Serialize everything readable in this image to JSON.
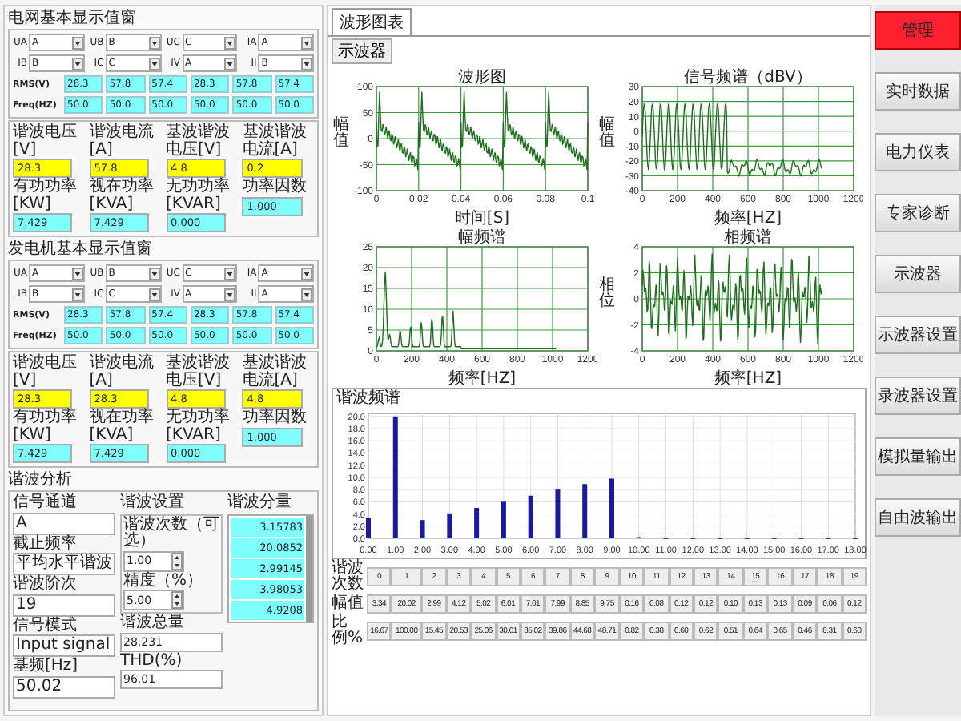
{
  "left_panel": {
    "groups": [
      {
        "title": "电网基本显示值窗",
        "selectors": [
          {
            "label": "UA",
            "value": "A"
          },
          {
            "label": "UB",
            "value": "B"
          },
          {
            "label": "UC",
            "value": "C"
          },
          {
            "label": "IA",
            "value": "A"
          },
          {
            "label": "IB",
            "value": "B"
          },
          {
            "label": "IC",
            "value": "C"
          },
          {
            "label": "IV",
            "value": "A"
          },
          {
            "label": "II",
            "value": "B"
          }
        ],
        "rms_label": "RMS(V)",
        "rms": [
          "28.3",
          "57.8",
          "57.4",
          "28.3",
          "57.8",
          "57.4"
        ],
        "freq_label": "Freq(HZ)",
        "freq": [
          "50.0",
          "50.0",
          "50.0",
          "50.0",
          "50.0",
          "50.0"
        ],
        "measures": [
          {
            "label": "谐波电压[V]",
            "value": "28.3",
            "color": "#ffff00"
          },
          {
            "label": "谐波电流[A]",
            "value": "57.8",
            "color": "#ffff00"
          },
          {
            "label": "基波谐波电压[V]",
            "value": "4.8",
            "color": "#ffff00"
          },
          {
            "label": "基波谐波电流[A]",
            "value": "0.2",
            "color": "#ffff00"
          },
          {
            "label": "有功功率[KW]",
            "value": "7.429",
            "color": "#80ffff"
          },
          {
            "label": "视在功率[KVA]",
            "value": "7.429",
            "color": "#80ffff"
          },
          {
            "label": "无功功率[KVAR]",
            "value": "0.000",
            "color": "#80ffff"
          },
          {
            "label": "功率因数",
            "value": "1.000",
            "color": "#80ffff"
          }
        ]
      },
      {
        "title": "发电机基本显示值窗",
        "selectors": [
          {
            "label": "UA",
            "value": "A"
          },
          {
            "label": "UB",
            "value": "B"
          },
          {
            "label": "UC",
            "value": "C"
          },
          {
            "label": "IA",
            "value": "A"
          },
          {
            "label": "IB",
            "value": "B"
          },
          {
            "label": "IC",
            "value": "C"
          },
          {
            "label": "IV",
            "value": "A"
          },
          {
            "label": "II",
            "value": "A"
          }
        ],
        "rms_label": "RMS(V)",
        "rms": [
          "28.3",
          "57.8",
          "57.4",
          "28.3",
          "57.8",
          "57.4"
        ],
        "freq_label": "Freq(HZ)",
        "freq": [
          "50.0",
          "50.0",
          "50.0",
          "50.0",
          "50.0",
          "50.0"
        ],
        "measures": [
          {
            "label": "谐波电压[V]",
            "value": "28.3",
            "color": "#ffff00"
          },
          {
            "label": "谐波电流[A]",
            "value": "28.3",
            "color": "#ffff00"
          },
          {
            "label": "基波谐波电压[V]",
            "value": "4.8",
            "color": "#ffff00"
          },
          {
            "label": "基波谐波电流[A]",
            "value": "4.8",
            "color": "#ffff00"
          },
          {
            "label": "有功功率[KW]",
            "value": "7.429",
            "color": "#80ffff"
          },
          {
            "label": "视在功率[KVA]",
            "value": "7.429",
            "color": "#80ffff"
          },
          {
            "label": "无功功率[KVAR]",
            "value": "0.000",
            "color": "#80ffff"
          },
          {
            "label": "功率因数",
            "value": "1.000",
            "color": "#80ffff"
          }
        ]
      }
    ],
    "analysis": {
      "title": "谐波分析",
      "fields": [
        {
          "label": "信号通道",
          "value": "A"
        },
        {
          "label": "截止频率",
          "value": "平均水平谐波"
        },
        {
          "label": "谐波阶次",
          "value": "19"
        },
        {
          "label": "信号模式",
          "value": "Input signal"
        },
        {
          "label": "基频[Hz]",
          "value": "50.02"
        }
      ],
      "settings": {
        "title": "谐波设置",
        "spinners": [
          {
            "label": "谐波次数（可选）",
            "value": "1.00"
          },
          {
            "label": "精度（%）",
            "value": "5.00"
          }
        ],
        "outputs": [
          {
            "label": "谐波总量",
            "value": "28.231"
          },
          {
            "label": "THD(%)",
            "value": "96.01"
          }
        ]
      },
      "components": {
        "title": "谐波分量",
        "values": [
          "3.15783",
          "20.0852",
          "2.99145",
          "3.98053",
          "4.9208"
        ]
      }
    }
  },
  "tabs": [
    {
      "label": "波形图表",
      "selected": true
    }
  ],
  "scope_button": "示波器",
  "charts": [
    {
      "kind": "time",
      "title": "波形图",
      "xlabel": "时间[S]",
      "ylabel": "幅值",
      "xticks": [
        "0",
        "0.02",
        "0.04",
        "0.06",
        "0.08",
        "0.1"
      ],
      "yticks": [
        "100",
        "50",
        "0",
        "-50",
        "-100"
      ]
    },
    {
      "kind": "db",
      "title": "信号频谱（dBV）",
      "xlabel": "频率[HZ]",
      "ylabel": "幅值",
      "xticks": [
        "0",
        "200",
        "400",
        "600",
        "800",
        "1000",
        "1200"
      ],
      "yticks": [
        "30",
        "20",
        "10",
        "0",
        "-10",
        "-20",
        "-30",
        "-40"
      ]
    },
    {
      "kind": "magnitude",
      "title": "幅频谱",
      "xlabel": "频率[HZ]",
      "xticks": [
        "0",
        "200",
        "400",
        "600",
        "800",
        "1000",
        "1200"
      ],
      "yticks": [
        "25",
        "20",
        "15",
        "10",
        "5",
        "0"
      ]
    },
    {
      "kind": "phase",
      "title": "相频谱",
      "xlabel": "频率[HZ]",
      "ylabel": "相位",
      "xticks": [
        "0",
        "200",
        "400",
        "600",
        "800",
        "1000",
        "1200"
      ],
      "yticks": [
        "4",
        "2",
        "0",
        "-2",
        "-4"
      ]
    }
  ],
  "harmonic_chart": {
    "chart_data": {
      "type": "bar",
      "title": "谐波频谱",
      "x": [
        0,
        1,
        2,
        3,
        4,
        5,
        6,
        7,
        8,
        9,
        10,
        11,
        12,
        13,
        14,
        15,
        16,
        17,
        18
      ],
      "values": [
        3.3,
        20,
        3,
        4.1,
        5,
        6,
        7,
        8,
        8.9,
        9.8,
        0.2,
        0.1,
        0.1,
        0.1,
        0.1,
        0.1,
        0.1,
        0.1,
        0.1
      ],
      "xlim": [
        0,
        18
      ],
      "ylim": [
        0,
        20.5
      ],
      "grid": true,
      "xticks": [
        {
          "value": 0,
          "label": "0.00"
        },
        {
          "value": 1,
          "label": "1.00"
        },
        {
          "value": 2,
          "label": "2.00"
        },
        {
          "value": 3,
          "label": "3.00"
        },
        {
          "value": 4,
          "label": "4.00"
        },
        {
          "value": 5,
          "label": "5.00"
        },
        {
          "value": 6,
          "label": "6.00"
        },
        {
          "value": 7,
          "label": "7.00"
        },
        {
          "value": 8,
          "label": "8.00"
        },
        {
          "value": 9,
          "label": "9.00"
        },
        {
          "value": 10,
          "label": "10.00"
        },
        {
          "value": 11,
          "label": "11.00"
        },
        {
          "value": 12,
          "label": "12.00"
        },
        {
          "value": 13,
          "label": "13.00"
        },
        {
          "value": 14,
          "label": "14.00"
        },
        {
          "value": 15,
          "label": "15.00"
        },
        {
          "value": 16,
          "label": "16.00"
        },
        {
          "value": 17,
          "label": "17.00"
        },
        {
          "value": 18,
          "label": "18.00"
        }
      ],
      "yticks": [
        {
          "value": 0,
          "label": "0.0"
        },
        {
          "value": 2,
          "label": "2.0"
        },
        {
          "value": 4,
          "label": "4.0"
        },
        {
          "value": 6,
          "label": "6.0"
        },
        {
          "value": 8,
          "label": "8.0"
        },
        {
          "value": 10,
          "label": "10.0"
        },
        {
          "value": 12,
          "label": "12.0"
        },
        {
          "value": 14,
          "label": "14.0"
        },
        {
          "value": 16,
          "label": "16.0"
        },
        {
          "value": 18,
          "label": "18.0"
        },
        {
          "value": 20,
          "label": "20.0"
        }
      ]
    }
  },
  "harmonic_table": {
    "rows": [
      {
        "label": "谐波次数",
        "cells": [
          "0",
          "1",
          "2",
          "3",
          "4",
          "5",
          "6",
          "7",
          "8",
          "9",
          "10",
          "11",
          "12",
          "13",
          "14",
          "15",
          "16",
          "17",
          "18",
          "19"
        ]
      },
      {
        "label": "幅值",
        "cells": [
          "3.34",
          "20.02",
          "2.99",
          "4.12",
          "5.02",
          "6.01",
          "7.01",
          "7.99",
          "8.85",
          "9.75",
          "0.16",
          "0.08",
          "0.12",
          "0.12",
          "0.10",
          "0.13",
          "0.13",
          "0.09",
          "0.06",
          "0.12"
        ]
      },
      {
        "label": "比例%",
        "cells": [
          "16.67",
          "100.00",
          "15.45",
          "20.53",
          "25.06",
          "30.01",
          "35.02",
          "39.86",
          "44.68",
          "48.71",
          "0.82",
          "0.38",
          "0.60",
          "0.62",
          "0.51",
          "0.64",
          "0.65",
          "0.46",
          "0.31",
          "0.60"
        ]
      }
    ]
  },
  "sidebar_buttons": [
    {
      "label": "管理",
      "kind": "alert"
    },
    {
      "label": "实时数据",
      "kind": "normal"
    },
    {
      "label": "电力仪表",
      "kind": "normal"
    },
    {
      "label": "专家诊断",
      "kind": "normal"
    },
    {
      "label": "示波器",
      "kind": "normal"
    },
    {
      "label": "示波器设置",
      "kind": "normal"
    },
    {
      "label": "录波器设置",
      "kind": "normal"
    },
    {
      "label": "模拟量输出",
      "kind": "normal"
    },
    {
      "label": "自由波输出",
      "kind": "normal"
    }
  ]
}
